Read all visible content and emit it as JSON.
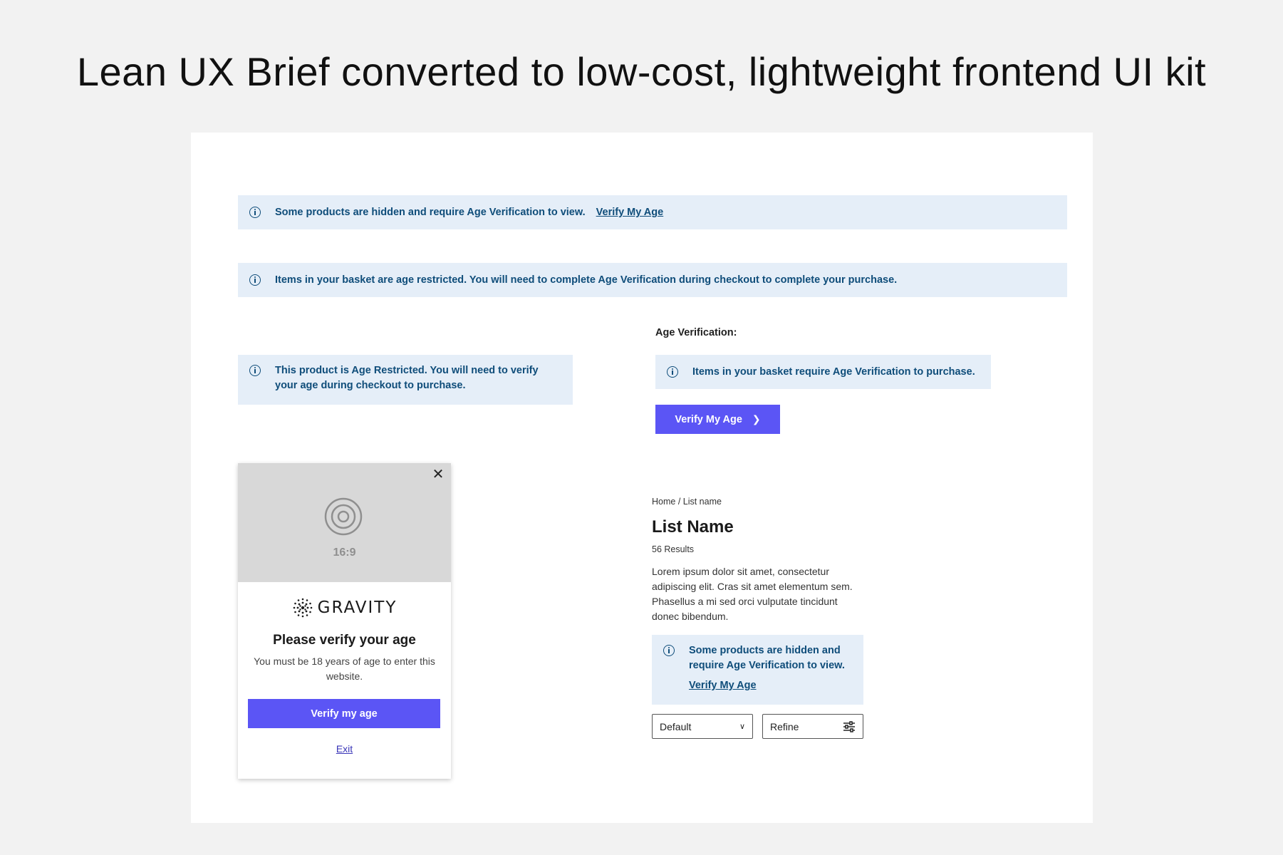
{
  "page": {
    "title": "Lean UX Brief converted to low-cost, lightweight frontend UI kit"
  },
  "colors": {
    "banner_bg": "#e5eef8",
    "banner_text": "#0f4d7a",
    "primary": "#5b55f5",
    "media_placeholder": "#d8d8d8"
  },
  "banners": {
    "hidden_products": {
      "text": "Some products are hidden and require Age Verification to view.",
      "link": "Verify My Age",
      "icon": "info-icon"
    },
    "basket_restricted": {
      "text": "Items in your basket are age restricted. You will need to complete Age Verification during checkout to complete your purchase.",
      "icon": "info-icon"
    },
    "product_restricted": {
      "text": "This product is Age Restricted. You will need to verify your age during checkout to purchase.",
      "icon": "info-icon"
    },
    "basket_require": {
      "text": "Items in your basket require Age Verification to purchase.",
      "icon": "info-icon"
    }
  },
  "age_verification": {
    "label": "Age Verification:",
    "button_label": "Verify My Age",
    "button_icon": "chevron-right-icon"
  },
  "modal": {
    "close_icon": "close-icon",
    "media_icon": "placeholder-icon",
    "media_ratio": "16:9",
    "brand_name": "GRAVITY",
    "heading": "Please verify your age",
    "body": "You must be 18 years of age to enter this website.",
    "cta": "Verify my age",
    "exit": "Exit"
  },
  "list_page": {
    "breadcrumb": "Home / List name",
    "title": "List Name",
    "results": "56 Results",
    "description": "Lorem ipsum dolor sit amet, consectetur adipiscing elit. Cras sit amet elementum sem. Phasellus a mi sed orci vulputate tincidunt donec bibendum.",
    "banner": {
      "text": "Some products are hidden and require Age Verification to view.",
      "link": "Verify My Age",
      "icon": "info-icon"
    },
    "sort": {
      "selected": "Default",
      "icon": "chevron-down-icon"
    },
    "refine": {
      "label": "Refine",
      "icon": "filter-icon"
    }
  }
}
